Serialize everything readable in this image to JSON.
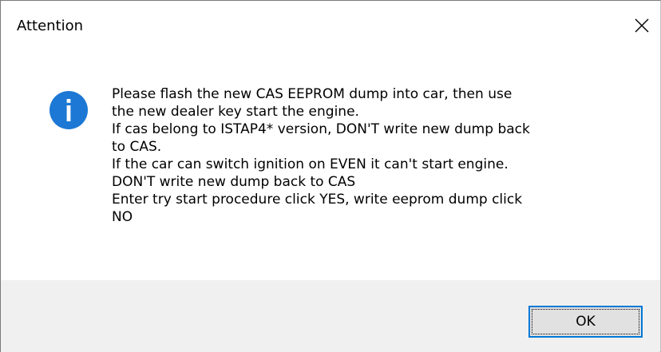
{
  "window": {
    "title": "Attention",
    "close_icon": "close-icon"
  },
  "message": {
    "icon": "info-icon",
    "icon_color": "#1c78d4",
    "lines": [
      "Please flash the new CAS EEPROM dump into car, then use",
      "the new dealer key start the engine.",
      "If cas belong to ISTAP4* version, DON'T write new dump back",
      "to CAS.",
      "If the car can switch ignition on EVEN it can't start engine.",
      "DON'T write new dump back to CAS",
      "Enter try start procedure click YES, write eeprom dump click",
      "NO"
    ]
  },
  "buttons": {
    "ok_label": "OK"
  },
  "colors": {
    "accent": "#0078d7",
    "footer_bg": "#f0f0f0"
  }
}
